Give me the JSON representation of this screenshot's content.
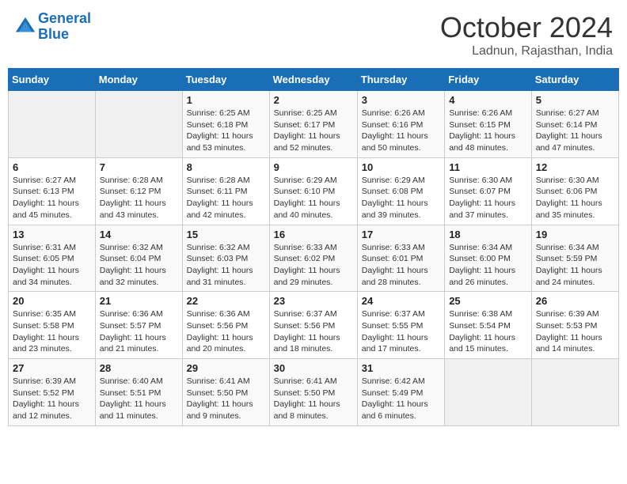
{
  "header": {
    "logo_line1": "General",
    "logo_line2": "Blue",
    "month": "October 2024",
    "location": "Ladnun, Rajasthan, India"
  },
  "weekdays": [
    "Sunday",
    "Monday",
    "Tuesday",
    "Wednesday",
    "Thursday",
    "Friday",
    "Saturday"
  ],
  "weeks": [
    [
      {
        "day": "",
        "info": ""
      },
      {
        "day": "",
        "info": ""
      },
      {
        "day": "1",
        "info": "Sunrise: 6:25 AM\nSunset: 6:18 PM\nDaylight: 11 hours and 53 minutes."
      },
      {
        "day": "2",
        "info": "Sunrise: 6:25 AM\nSunset: 6:17 PM\nDaylight: 11 hours and 52 minutes."
      },
      {
        "day": "3",
        "info": "Sunrise: 6:26 AM\nSunset: 6:16 PM\nDaylight: 11 hours and 50 minutes."
      },
      {
        "day": "4",
        "info": "Sunrise: 6:26 AM\nSunset: 6:15 PM\nDaylight: 11 hours and 48 minutes."
      },
      {
        "day": "5",
        "info": "Sunrise: 6:27 AM\nSunset: 6:14 PM\nDaylight: 11 hours and 47 minutes."
      }
    ],
    [
      {
        "day": "6",
        "info": "Sunrise: 6:27 AM\nSunset: 6:13 PM\nDaylight: 11 hours and 45 minutes."
      },
      {
        "day": "7",
        "info": "Sunrise: 6:28 AM\nSunset: 6:12 PM\nDaylight: 11 hours and 43 minutes."
      },
      {
        "day": "8",
        "info": "Sunrise: 6:28 AM\nSunset: 6:11 PM\nDaylight: 11 hours and 42 minutes."
      },
      {
        "day": "9",
        "info": "Sunrise: 6:29 AM\nSunset: 6:10 PM\nDaylight: 11 hours and 40 minutes."
      },
      {
        "day": "10",
        "info": "Sunrise: 6:29 AM\nSunset: 6:08 PM\nDaylight: 11 hours and 39 minutes."
      },
      {
        "day": "11",
        "info": "Sunrise: 6:30 AM\nSunset: 6:07 PM\nDaylight: 11 hours and 37 minutes."
      },
      {
        "day": "12",
        "info": "Sunrise: 6:30 AM\nSunset: 6:06 PM\nDaylight: 11 hours and 35 minutes."
      }
    ],
    [
      {
        "day": "13",
        "info": "Sunrise: 6:31 AM\nSunset: 6:05 PM\nDaylight: 11 hours and 34 minutes."
      },
      {
        "day": "14",
        "info": "Sunrise: 6:32 AM\nSunset: 6:04 PM\nDaylight: 11 hours and 32 minutes."
      },
      {
        "day": "15",
        "info": "Sunrise: 6:32 AM\nSunset: 6:03 PM\nDaylight: 11 hours and 31 minutes."
      },
      {
        "day": "16",
        "info": "Sunrise: 6:33 AM\nSunset: 6:02 PM\nDaylight: 11 hours and 29 minutes."
      },
      {
        "day": "17",
        "info": "Sunrise: 6:33 AM\nSunset: 6:01 PM\nDaylight: 11 hours and 28 minutes."
      },
      {
        "day": "18",
        "info": "Sunrise: 6:34 AM\nSunset: 6:00 PM\nDaylight: 11 hours and 26 minutes."
      },
      {
        "day": "19",
        "info": "Sunrise: 6:34 AM\nSunset: 5:59 PM\nDaylight: 11 hours and 24 minutes."
      }
    ],
    [
      {
        "day": "20",
        "info": "Sunrise: 6:35 AM\nSunset: 5:58 PM\nDaylight: 11 hours and 23 minutes."
      },
      {
        "day": "21",
        "info": "Sunrise: 6:36 AM\nSunset: 5:57 PM\nDaylight: 11 hours and 21 minutes."
      },
      {
        "day": "22",
        "info": "Sunrise: 6:36 AM\nSunset: 5:56 PM\nDaylight: 11 hours and 20 minutes."
      },
      {
        "day": "23",
        "info": "Sunrise: 6:37 AM\nSunset: 5:56 PM\nDaylight: 11 hours and 18 minutes."
      },
      {
        "day": "24",
        "info": "Sunrise: 6:37 AM\nSunset: 5:55 PM\nDaylight: 11 hours and 17 minutes."
      },
      {
        "day": "25",
        "info": "Sunrise: 6:38 AM\nSunset: 5:54 PM\nDaylight: 11 hours and 15 minutes."
      },
      {
        "day": "26",
        "info": "Sunrise: 6:39 AM\nSunset: 5:53 PM\nDaylight: 11 hours and 14 minutes."
      }
    ],
    [
      {
        "day": "27",
        "info": "Sunrise: 6:39 AM\nSunset: 5:52 PM\nDaylight: 11 hours and 12 minutes."
      },
      {
        "day": "28",
        "info": "Sunrise: 6:40 AM\nSunset: 5:51 PM\nDaylight: 11 hours and 11 minutes."
      },
      {
        "day": "29",
        "info": "Sunrise: 6:41 AM\nSunset: 5:50 PM\nDaylight: 11 hours and 9 minutes."
      },
      {
        "day": "30",
        "info": "Sunrise: 6:41 AM\nSunset: 5:50 PM\nDaylight: 11 hours and 8 minutes."
      },
      {
        "day": "31",
        "info": "Sunrise: 6:42 AM\nSunset: 5:49 PM\nDaylight: 11 hours and 6 minutes."
      },
      {
        "day": "",
        "info": ""
      },
      {
        "day": "",
        "info": ""
      }
    ]
  ]
}
